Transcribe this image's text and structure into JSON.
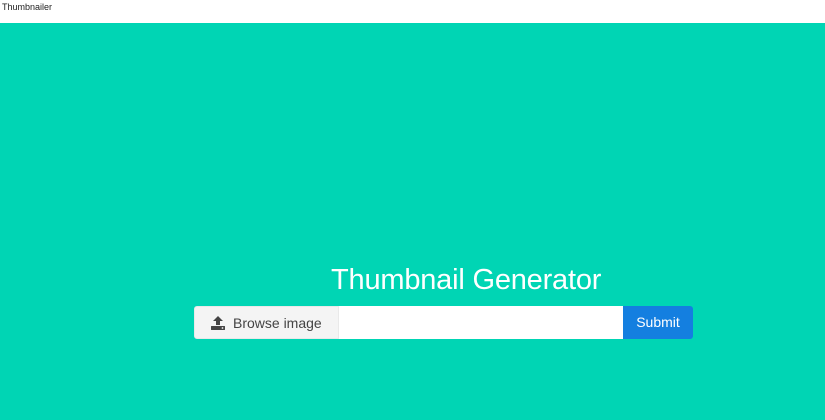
{
  "navbar": {
    "brand": "Thumbnailer"
  },
  "hero": {
    "title": "Thumbnail Generator"
  },
  "form": {
    "browse_label": "Browse image",
    "browse_icon": "upload-icon",
    "file_value": "",
    "submit_label": "Submit"
  },
  "colors": {
    "hero_background": "#00d5b4",
    "submit_background": "#147fe0",
    "browse_background": "#f4f4f4"
  }
}
